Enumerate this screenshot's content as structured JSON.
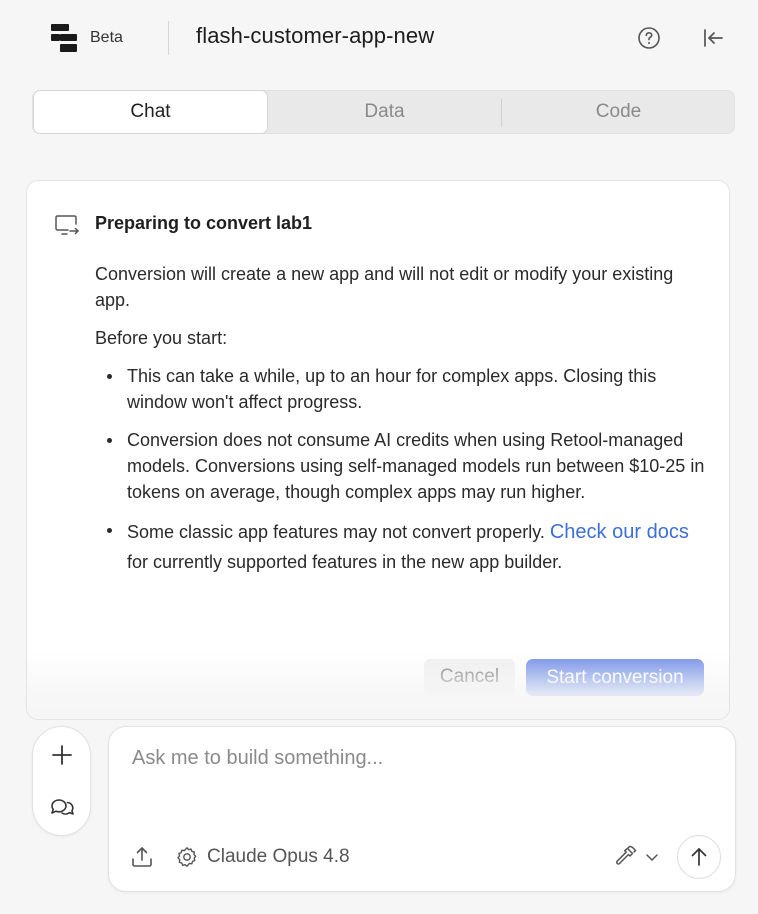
{
  "header": {
    "badge": "Beta",
    "title": "flash-customer-app-new"
  },
  "tabs": [
    {
      "label": "Chat",
      "active": true
    },
    {
      "label": "Data",
      "active": false
    },
    {
      "label": "Code",
      "active": false
    }
  ],
  "card": {
    "title": "Preparing to convert lab1",
    "intro": "Conversion will create a new app and will not edit or modify your existing app.",
    "before_start": "Before you start:",
    "bullets": {
      "b1": "This can take a while, up to an hour for complex apps. Closing this window won't affect progress.",
      "b2": "Conversion does not consume AI credits when using Retool-managed models. Conversions using self-managed models run between $10-25 in tokens on average, though complex apps may run higher.",
      "b3_pre": "Some classic app features may not convert properly. ",
      "b3_link": "Check our docs",
      "b3_post": " for currently supported features in the new app builder."
    },
    "cancel_label": "Cancel",
    "start_label": "Start conversion"
  },
  "composer": {
    "placeholder": "Ask me to build something...",
    "model": "Claude Opus 4.8"
  },
  "colors": {
    "accent": "#6d8be8",
    "link": "#3d6fd8"
  },
  "icons": {
    "logo": "retool-logo",
    "help": "question-circle-icon",
    "collapse": "collapse-left-icon",
    "card": "monitor-convert-icon",
    "plus": "plus-icon",
    "chats": "chat-bubbles-icon",
    "upload": "upload-icon",
    "settings": "gear-icon",
    "tools": "hammer-icon",
    "send": "arrow-up-icon"
  }
}
